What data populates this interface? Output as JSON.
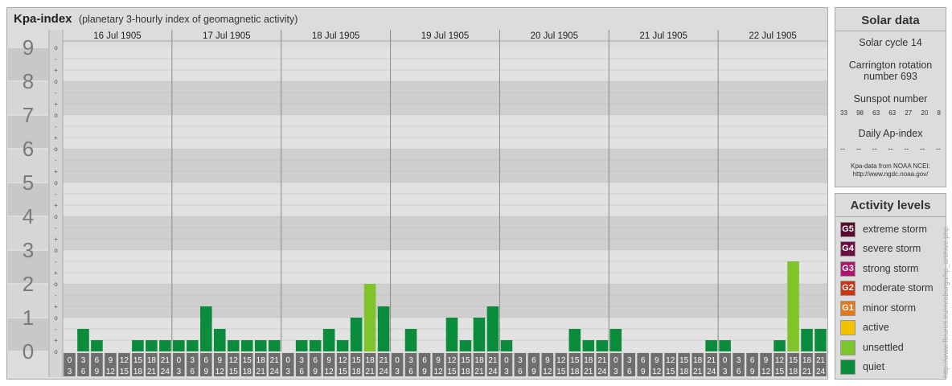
{
  "header": {
    "title": "Kpa-index",
    "subtitle": "(planetary 3-hourly index of geomagnetic activity)"
  },
  "solar": {
    "heading": "Solar data",
    "cycle": "Solar cycle 14",
    "carrington_line1": "Carrington rotation",
    "carrington_line2": "number 693",
    "sunspot_heading": "Sunspot number",
    "sunspot_values": [
      "33",
      "98",
      "63",
      "63",
      "27",
      "20",
      "8"
    ],
    "ap_heading": "Daily Ap-index",
    "ap_values": [
      "--",
      "--",
      "--",
      "--",
      "--",
      "--",
      "--"
    ],
    "source_line1": "Kpa-data from NOAA NCEI:",
    "source_line2": "http://www.ngdc.noaa.gov/"
  },
  "activity": {
    "heading": "Activity levels",
    "levels": [
      {
        "badge": "G5",
        "label": "extreme storm",
        "color": "#5a0a2c"
      },
      {
        "badge": "G4",
        "label": "severe storm",
        "color": "#6d0e40"
      },
      {
        "badge": "G3",
        "label": "strong storm",
        "color": "#b0156b"
      },
      {
        "badge": "G2",
        "label": "moderate storm",
        "color": "#cc3311"
      },
      {
        "badge": "G1",
        "label": "minor storm",
        "color": "#e07a1a"
      },
      {
        "badge": "",
        "label": "active",
        "color": "#f2c200"
      },
      {
        "badge": "",
        "label": "unsettled",
        "color": "#7fc42a"
      },
      {
        "badge": "",
        "label": "quiet",
        "color": "#0b8c3c"
      }
    ]
  },
  "credit": "http://www.fleuriet.eu/mraburgo/kp_archive.php",
  "chart_data": {
    "type": "bar",
    "title": "Kpa-index",
    "ylim": [
      0,
      9
    ],
    "y_ticks": [
      "0",
      "1",
      "2",
      "3",
      "4",
      "5",
      "6",
      "7",
      "8",
      "9"
    ],
    "minor_ticks": [
      "o",
      "+",
      "-"
    ],
    "days": [
      "16 Jul 1905",
      "17 Jul 1905",
      "18 Jul 1905",
      "19 Jul 1905",
      "20 Jul 1905",
      "21 Jul 1905",
      "22 Jul 1905"
    ],
    "hour_labels_top": [
      "0",
      "3",
      "6",
      "9",
      "12",
      "15",
      "18",
      "21"
    ],
    "hour_labels_bottom": [
      "3",
      "6",
      "9",
      "12",
      "15",
      "18",
      "21",
      "24"
    ],
    "series": [
      {
        "values": [
          0,
          0.667,
          0.333,
          0,
          0,
          0.333,
          0.333,
          0.333,
          0.333,
          0.333,
          1.333,
          0.667,
          0.333,
          0.333,
          0.333,
          0.333,
          0,
          0.333,
          0.333,
          0.667,
          0.333,
          1,
          2,
          1.333,
          0,
          0.667,
          0,
          0,
          1,
          0.333,
          1,
          1.333,
          0.333,
          0,
          0,
          0,
          0,
          0.667,
          0.333,
          0.333,
          0.667,
          0,
          0,
          0,
          0,
          0,
          0,
          0.333,
          0.333,
          0,
          0,
          0,
          0.333,
          2.667,
          0.667,
          0.667
        ]
      }
    ],
    "colors": {
      "quiet": "#0b8c3c",
      "unsettled": "#7fc42a",
      "active": "#f2c200"
    }
  }
}
